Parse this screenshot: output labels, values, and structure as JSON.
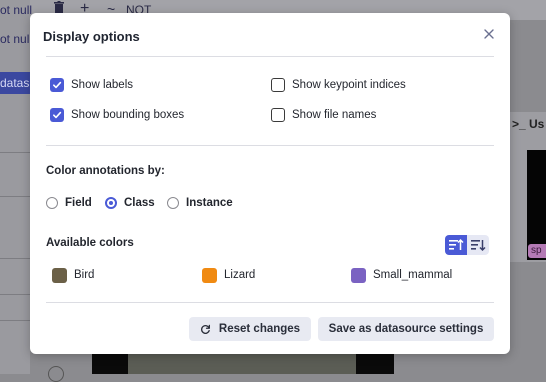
{
  "background": {
    "filter_text_1": "ot null",
    "filter_text_2": "ot null",
    "not_label": "NOT",
    "dataset_chip": "datas",
    "right_panel_label": "Us",
    "badge_text": "sp"
  },
  "modal": {
    "title": "Display options",
    "close_icon": "close-icon",
    "options": {
      "show_labels": {
        "label": "Show labels",
        "checked": true
      },
      "show_keypoint_indices": {
        "label": "Show keypoint indices",
        "checked": false
      },
      "show_bounding_boxes": {
        "label": "Show bounding boxes",
        "checked": true
      },
      "show_file_names": {
        "label": "Show file names",
        "checked": false
      }
    },
    "color_by": {
      "label": "Color annotations by:",
      "options": [
        {
          "label": "Field",
          "selected": false
        },
        {
          "label": "Class",
          "selected": true
        },
        {
          "label": "Instance",
          "selected": false
        }
      ]
    },
    "available_colors": {
      "label": "Available colors",
      "sort_icons": [
        "sort-ascending-icon",
        "sort-descending-icon"
      ],
      "items": [
        {
          "label": "Bird",
          "color": "#6b6047"
        },
        {
          "label": "Lizard",
          "color": "#f08a12"
        },
        {
          "label": "Small_mammal",
          "color": "#7a62c2"
        }
      ]
    },
    "buttons": {
      "reset": "Reset changes",
      "save": "Save as datasource settings"
    },
    "accent_color": "#4a5ad6"
  }
}
